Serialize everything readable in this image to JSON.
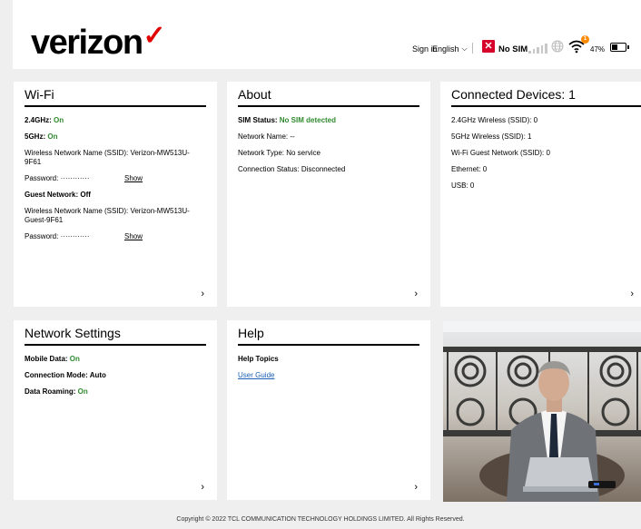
{
  "header": {
    "brand": "verizon",
    "brand_mark": "✓",
    "sign_in": "Sign in",
    "language": "English",
    "sim_status": "No SIM",
    "battery": "47%",
    "battery_level": 0.47,
    "wifi_badge": "1"
  },
  "wifi": {
    "title": "Wi-Fi",
    "band24_label": "2.4GHz: ",
    "band24_value": "On",
    "band5_label": "5GHz: ",
    "band5_value": "On",
    "ssid": "Wireless Network Name (SSID): Verizon-MW513U-9F61",
    "password": "Password: ············",
    "show": "Show",
    "guest_label": "Guest Network: Off",
    "guest_ssid": "Wireless Network Name (SSID): Verizon-MW513U-Guest-9F61",
    "guest_password": "Password: ············",
    "guest_show": "Show",
    "arrow": "›"
  },
  "about": {
    "title": "About",
    "sim_label": "SIM Status: ",
    "sim_value": "No SIM detected",
    "network_name": "Network Name: --",
    "network_type": "Network Type: No service",
    "connection_status": "Connection Status: Disconnected",
    "arrow": "›"
  },
  "devices": {
    "title": "Connected Devices: 1",
    "ssid24": "2.4GHz Wireless (SSID): 0",
    "ssid5": "5GHz Wireless (SSID): 1",
    "guest": "Wi-Fi Guest Network (SSID): 0",
    "ethernet": "Ethernet: 0",
    "usb": "USB: 0",
    "arrow": "›"
  },
  "network": {
    "title": "Network Settings",
    "mobile_label": "Mobile Data: ",
    "mobile_value": "On",
    "connection_mode": "Connection Mode: Auto",
    "roaming_label": "Data Roaming: ",
    "roaming_value": "On",
    "arrow": "›"
  },
  "help": {
    "title": "Help",
    "topics": "Help Topics",
    "user_guide": "User Guide",
    "arrow": "›"
  },
  "footer": {
    "copyright": "Copyright © 2022 TCL COMMUNICATION TECHNOLOGY HOLDINGS LIMITED. All Rights Reserved."
  },
  "colors": {
    "brand_red": "#e00000",
    "status_green": "#2f8a2f",
    "link_blue": "#1a5fb4",
    "wifi_badge_orange": "#ff8a00"
  }
}
